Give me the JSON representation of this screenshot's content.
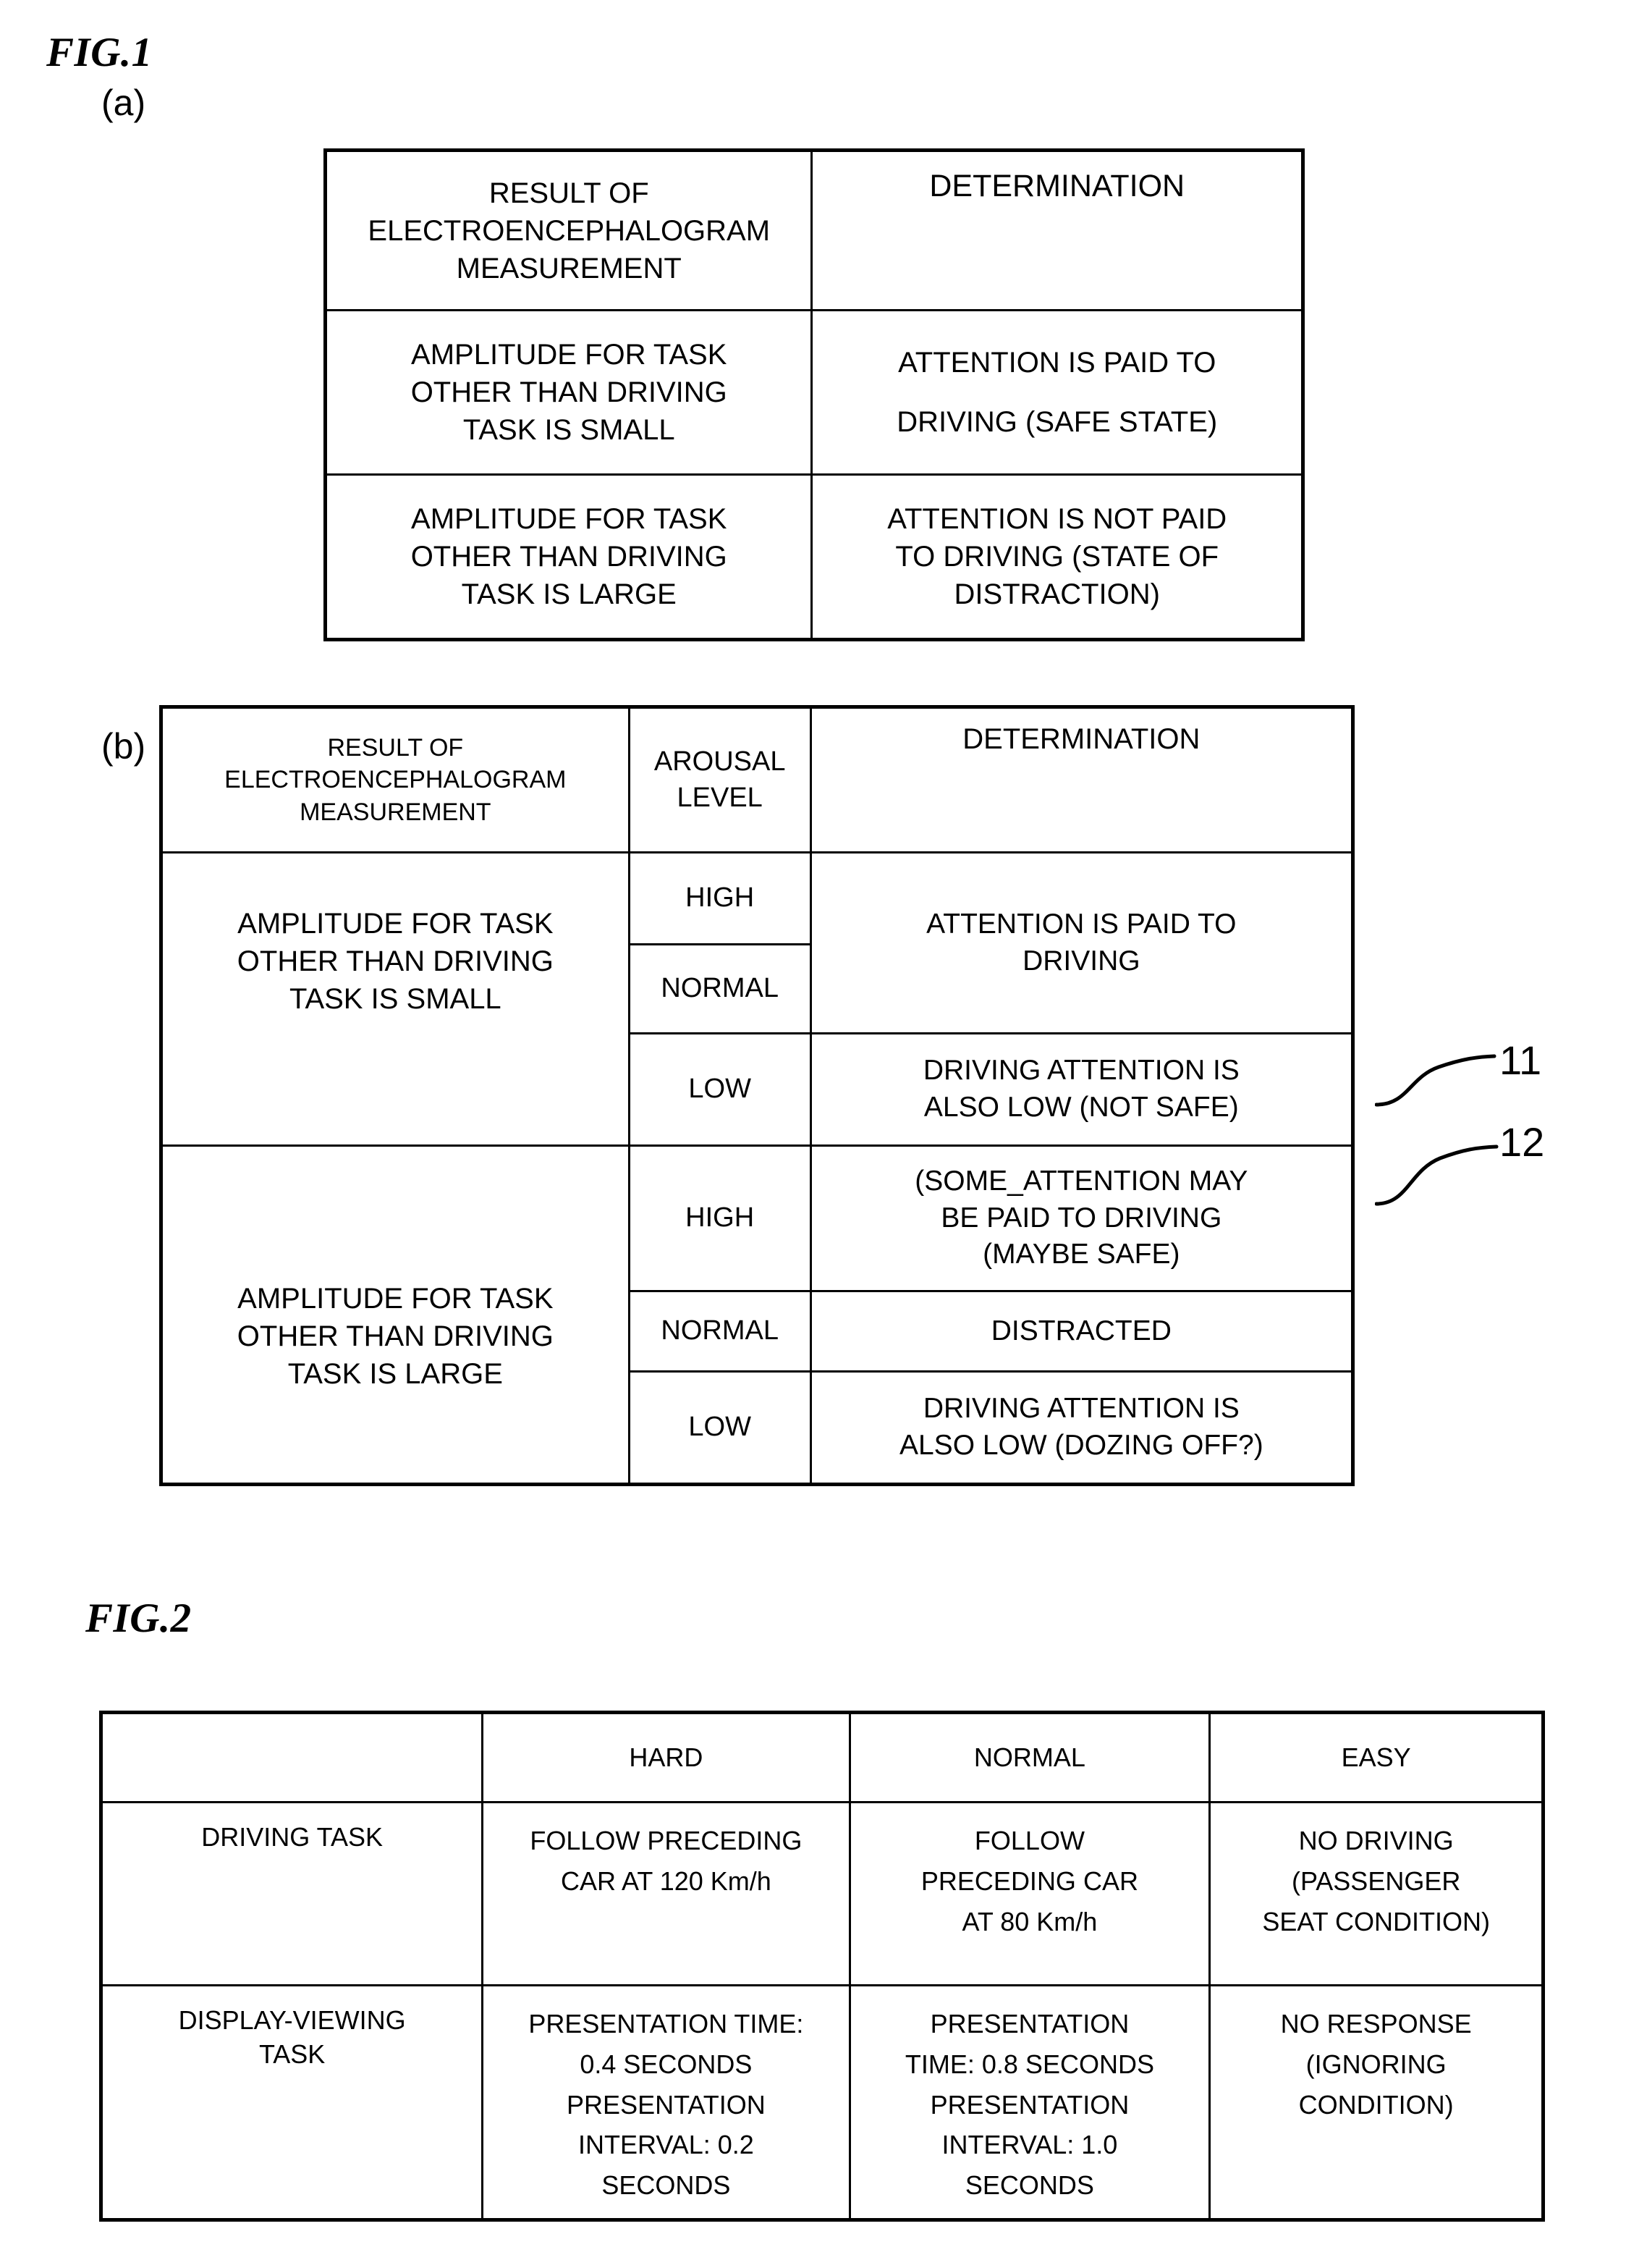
{
  "figures": [
    {
      "id": "fig1",
      "caption": "FIG.1",
      "subfigures": [
        {
          "key": "a",
          "label": "(a)"
        },
        {
          "key": "b",
          "label": "(b)"
        }
      ]
    },
    {
      "id": "fig2",
      "caption": "FIG.2"
    }
  ],
  "table_a": {
    "headers": {
      "result": "RESULT OF ELECTROENCEPHALOGRAM MEASUREMENT",
      "result_lines": [
        "RESULT OF",
        "ELECTROENCEPHALOGRAM",
        "MEASUREMENT"
      ],
      "determination": "DETERMINATION"
    },
    "rows": [
      {
        "result_lines": [
          "AMPLITUDE FOR TASK",
          "OTHER THAN DRIVING",
          "TASK IS SMALL"
        ],
        "determination_lines": [
          "ATTENTION IS PAID TO",
          "DRIVING (SAFE STATE)"
        ]
      },
      {
        "result_lines": [
          "AMPLITUDE FOR TASK",
          "OTHER THAN DRIVING",
          "TASK IS LARGE"
        ],
        "determination_lines": [
          "ATTENTION IS NOT PAID",
          "TO DRIVING (STATE OF",
          "DISTRACTION)"
        ]
      }
    ]
  },
  "table_b": {
    "headers": {
      "result_lines": [
        "RESULT OF",
        "ELECTROENCEPHALOGRAM",
        "MEASUREMENT"
      ],
      "arousal_lines": [
        "AROUSAL",
        "LEVEL"
      ],
      "determination": "DETERMINATION"
    },
    "groups": [
      {
        "result_lines": [
          "AMPLITUDE FOR TASK",
          "OTHER THAN DRIVING",
          "TASK IS SMALL"
        ],
        "entries": [
          {
            "arousal": "HIGH",
            "determination_lines": [
              "ATTENTION IS PAID TO",
              "DRIVING"
            ]
          },
          {
            "arousal": "NORMAL",
            "determination_lines": []
          },
          {
            "arousal": "LOW",
            "determination_lines": [
              "DRIVING ATTENTION IS",
              "ALSO LOW (NOT SAFE)"
            ]
          }
        ]
      },
      {
        "result_lines": [
          "AMPLITUDE FOR TASK",
          "OTHER THAN DRIVING",
          "TASK IS LARGE"
        ],
        "entries": [
          {
            "arousal": "HIGH",
            "determination_lines": [
              "(SOME_ATTENTION MAY",
              "BE PAID TO DRIVING",
              "(MAYBE SAFE)"
            ]
          },
          {
            "arousal": "NORMAL",
            "determination_lines": [
              "DISTRACTED"
            ]
          },
          {
            "arousal": "LOW",
            "determination_lines": [
              "DRIVING ATTENTION IS",
              "ALSO LOW (DOZING OFF?)"
            ]
          }
        ]
      }
    ],
    "callouts": [
      {
        "number": "11",
        "target": "DRIVING ATTENTION IS ALSO LOW (NOT SAFE)"
      },
      {
        "number": "12",
        "target": "(SOME ATTENTION MAY BE PAID TO DRIVING (MAYBE SAFE)"
      }
    ]
  },
  "table_fig2": {
    "headers": [
      "",
      "HARD",
      "NORMAL",
      "EASY"
    ],
    "rows": [
      {
        "label_lines": [
          "DRIVING TASK"
        ],
        "cells": [
          [
            "FOLLOW PRECEDING",
            "CAR AT 120 Km/h"
          ],
          [
            "FOLLOW",
            "PRECEDING CAR",
            "AT 80 Km/h"
          ],
          [
            "NO DRIVING",
            "(PASSENGER",
            "SEAT CONDITION)"
          ]
        ]
      },
      {
        "label_lines": [
          "DISPLAY-VIEWING",
          "TASK"
        ],
        "cells": [
          [
            "PRESENTATION TIME:",
            "0.4 SECONDS",
            "PRESENTATION",
            "INTERVAL: 0.2",
            "SECONDS"
          ],
          [
            "PRESENTATION",
            "TIME: 0.8 SECONDS",
            "PRESENTATION",
            "INTERVAL: 1.0",
            "SECONDS"
          ],
          [
            "NO RESPONSE",
            "(IGNORING",
            "CONDITION)"
          ]
        ]
      }
    ]
  }
}
